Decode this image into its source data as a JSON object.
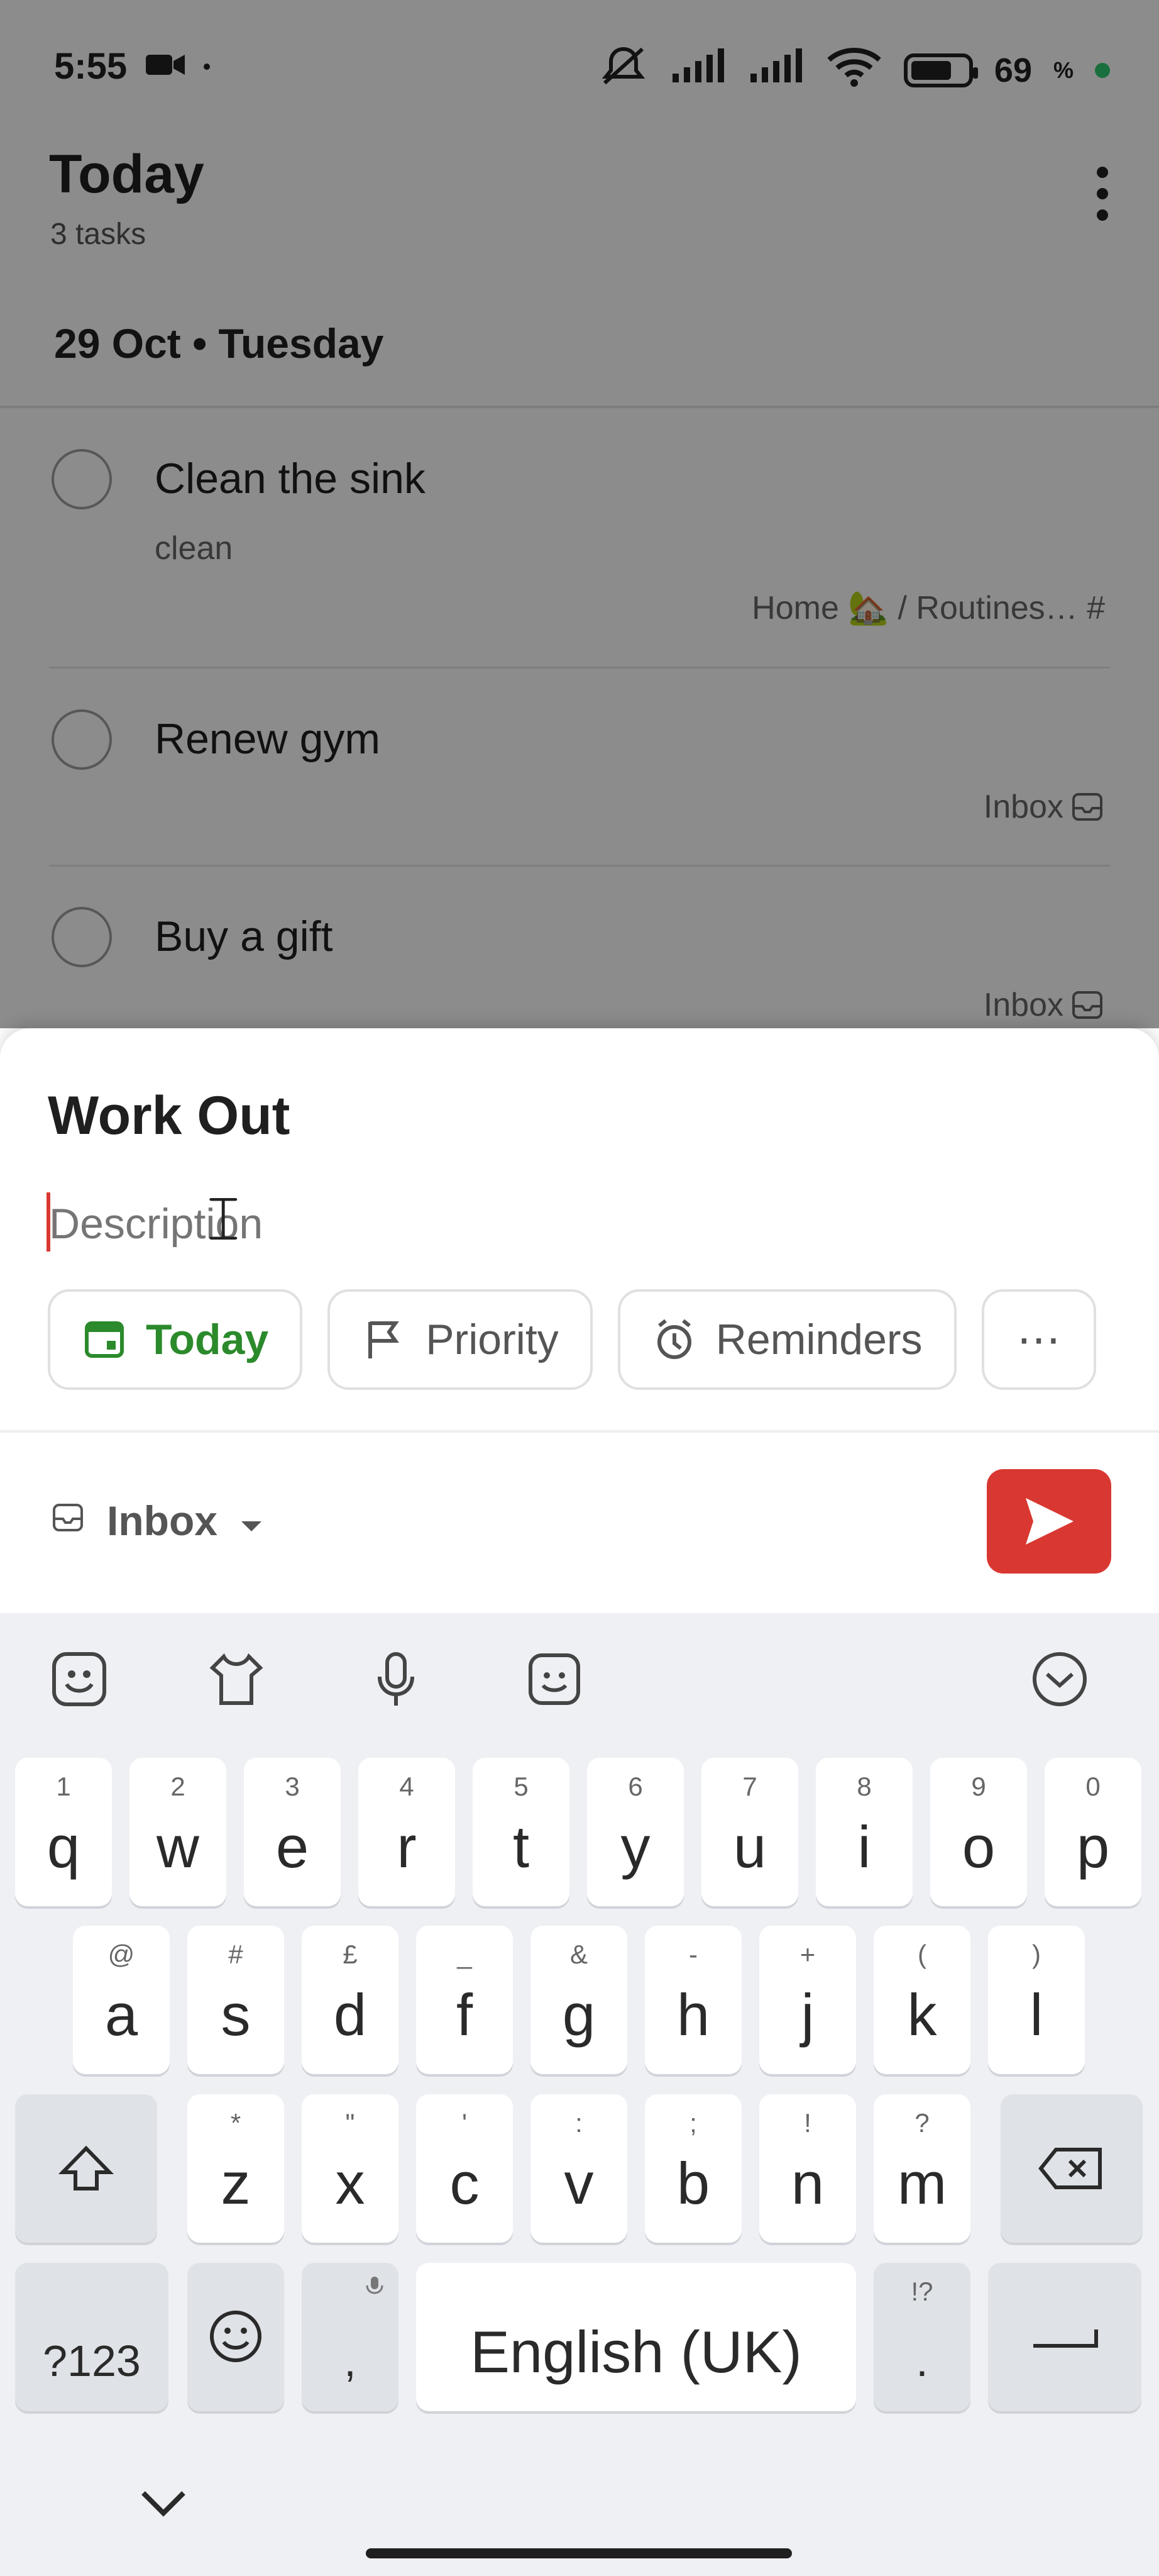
{
  "status_bar": {
    "time": "5:55",
    "battery": "69"
  },
  "header": {
    "title": "Today",
    "subtitle": "3 tasks"
  },
  "section": {
    "date": "29 Oct • Tuesday"
  },
  "tasks": [
    {
      "title": "Clean the sink",
      "description": "clean",
      "project": "Home 🏡 / Routines… #"
    },
    {
      "title": "Renew gym",
      "project": "Inbox"
    },
    {
      "title": "Buy a gift",
      "project": "Inbox"
    }
  ],
  "sheet": {
    "task_name": "Work Out",
    "description_placeholder": "Description",
    "chips": {
      "today": "Today",
      "priority": "Priority",
      "reminders": "Reminders",
      "more": "⋯"
    },
    "project": "Inbox"
  },
  "keyboard": {
    "row1": [
      {
        "main": "q",
        "alt": "1"
      },
      {
        "main": "w",
        "alt": "2"
      },
      {
        "main": "e",
        "alt": "3"
      },
      {
        "main": "r",
        "alt": "4"
      },
      {
        "main": "t",
        "alt": "5"
      },
      {
        "main": "y",
        "alt": "6"
      },
      {
        "main": "u",
        "alt": "7"
      },
      {
        "main": "i",
        "alt": "8"
      },
      {
        "main": "o",
        "alt": "9"
      },
      {
        "main": "p",
        "alt": "0"
      }
    ],
    "row2": [
      {
        "main": "a",
        "alt": "@"
      },
      {
        "main": "s",
        "alt": "#"
      },
      {
        "main": "d",
        "alt": "£"
      },
      {
        "main": "f",
        "alt": "_"
      },
      {
        "main": "g",
        "alt": "&"
      },
      {
        "main": "h",
        "alt": "-"
      },
      {
        "main": "j",
        "alt": "+"
      },
      {
        "main": "k",
        "alt": "("
      },
      {
        "main": "l",
        "alt": ")"
      }
    ],
    "row3": [
      {
        "main": "z",
        "alt": "*"
      },
      {
        "main": "x",
        "alt": "\""
      },
      {
        "main": "c",
        "alt": "'"
      },
      {
        "main": "v",
        "alt": ":"
      },
      {
        "main": "b",
        "alt": ";"
      },
      {
        "main": "n",
        "alt": "!"
      },
      {
        "main": "m",
        "alt": "?"
      }
    ],
    "bottom": {
      "symbols": "?123",
      "comma": ",",
      "space": "English (UK)",
      "period": ".",
      "period_alt": "!?"
    }
  }
}
